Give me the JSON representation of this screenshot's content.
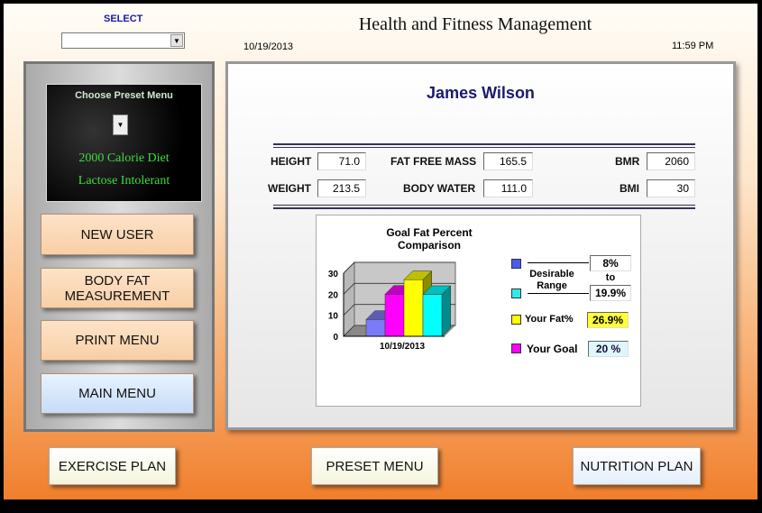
{
  "header": {
    "select_label": "SELECT",
    "select_value": "",
    "title": "Health and Fitness Management",
    "date": "10/19/2013",
    "time": "11:59 PM"
  },
  "preset": {
    "title": "Choose Preset Menu",
    "items": [
      "2000 Calorie Diet",
      "Lactose Intolerant"
    ]
  },
  "sidebar": {
    "buttons": [
      "NEW USER",
      "BODY FAT MEASUREMENT",
      "PRINT MENU",
      "MAIN MENU"
    ]
  },
  "user": {
    "name": "James Wilson"
  },
  "stats": {
    "height_label": "HEIGHT",
    "height": "71.0",
    "weight_label": "WEIGHT",
    "weight": "213.5",
    "ffm_label": "FAT FREE MASS",
    "ffm": "165.5",
    "water_label": "BODY WATER",
    "water": "111.0",
    "bmr_label": "BMR",
    "bmr": "2060",
    "bmi_label": "BMI",
    "bmi": "30"
  },
  "legend": {
    "range_label": "Desirable Range",
    "range_low": "8%",
    "to": "to",
    "range_high": "19.9%",
    "fat_label": "Your Fat%",
    "fat": "26.9%",
    "goal_label": "Your Goal",
    "goal": "20 %"
  },
  "colors": {
    "blue": "#7b7bf5",
    "magenta": "#ff00ff",
    "yellow": "#ffff00",
    "cyan": "#00ffff"
  },
  "chart_data": {
    "type": "bar",
    "title": "Goal Fat Percent Comparison",
    "categories": [
      "10/19/2013"
    ],
    "series": [
      {
        "name": "Desirable Range Low",
        "value": 8,
        "color": "#7b7bf5"
      },
      {
        "name": "Your Goal",
        "value": 20,
        "color": "#ff00ff"
      },
      {
        "name": "Your Fat%",
        "value": 26.9,
        "color": "#ffff00"
      },
      {
        "name": "Desirable Range High",
        "value": 19.9,
        "color": "#00ffff"
      }
    ],
    "yticks": [
      "0",
      "10",
      "20",
      "30"
    ],
    "ylim": [
      0,
      30
    ]
  },
  "bottom": {
    "buttons": [
      "EXERCISE PLAN",
      "PRESET MENU",
      "NUTRITION PLAN"
    ]
  }
}
